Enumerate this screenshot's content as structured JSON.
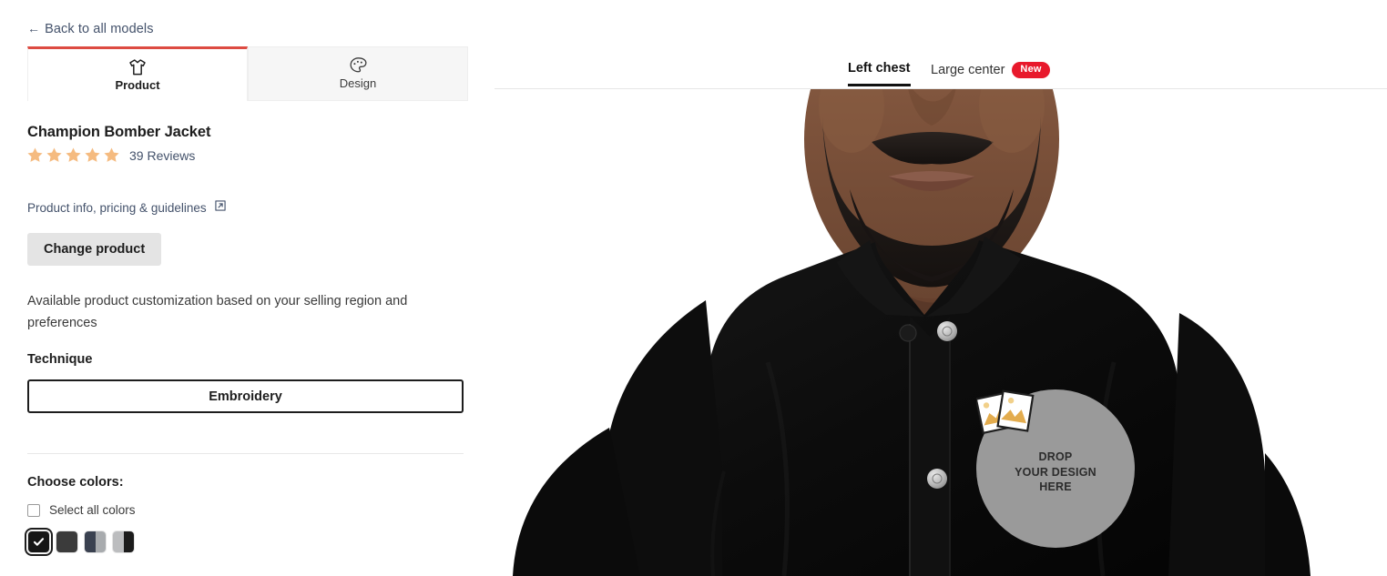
{
  "left": {
    "back_link": "Back to all models",
    "back_arrow_icon": "arrow-left-icon",
    "tabs": [
      {
        "label": "Product",
        "icon": "tshirt-icon",
        "active": true
      },
      {
        "label": "Design",
        "icon": "palette-icon",
        "active": false
      }
    ],
    "product_title": "Champion Bomber Jacket",
    "rating": {
      "stars": 5,
      "star_color": "#f5bb80",
      "reviews_label": "39 Reviews"
    },
    "info_link": "Product info, pricing & guidelines",
    "info_link_icon": "external-link-icon",
    "change_product_button": "Change product",
    "availability_text": "Available product customization based on your selling region and preferences",
    "technique_label": "Technique",
    "technique_value": "Embroidery",
    "choose_colors_label": "Choose colors:",
    "select_all_label": "Select all colors",
    "select_all_checked": false,
    "swatches": [
      {
        "name": "black",
        "colors": [
          "#161616"
        ],
        "selected": true
      },
      {
        "name": "charcoal",
        "colors": [
          "#3b3b3b"
        ],
        "selected": false
      },
      {
        "name": "navy-grey",
        "colors": [
          "#3a4150",
          "#a8abae"
        ],
        "selected": false
      },
      {
        "name": "grey-black",
        "colors": [
          "#bcbdbf",
          "#1c1c1c"
        ],
        "selected": false
      }
    ]
  },
  "right": {
    "placement_tabs": [
      {
        "label": "Left chest",
        "active": true,
        "badge": null
      },
      {
        "label": "Large center",
        "active": false,
        "badge": "New"
      }
    ],
    "dropzone": {
      "line1": "DROP",
      "line2": "YOUR DESIGN",
      "line3": "HERE",
      "icon": "photos-icon",
      "background": "#9a9a9a"
    }
  },
  "colors": {
    "accent_red": "#dd4b42",
    "badge_red": "#e8192c",
    "link_slate": "#44526b",
    "star_orange": "#f5bb80",
    "jacket_black": "#0e0e0e"
  }
}
